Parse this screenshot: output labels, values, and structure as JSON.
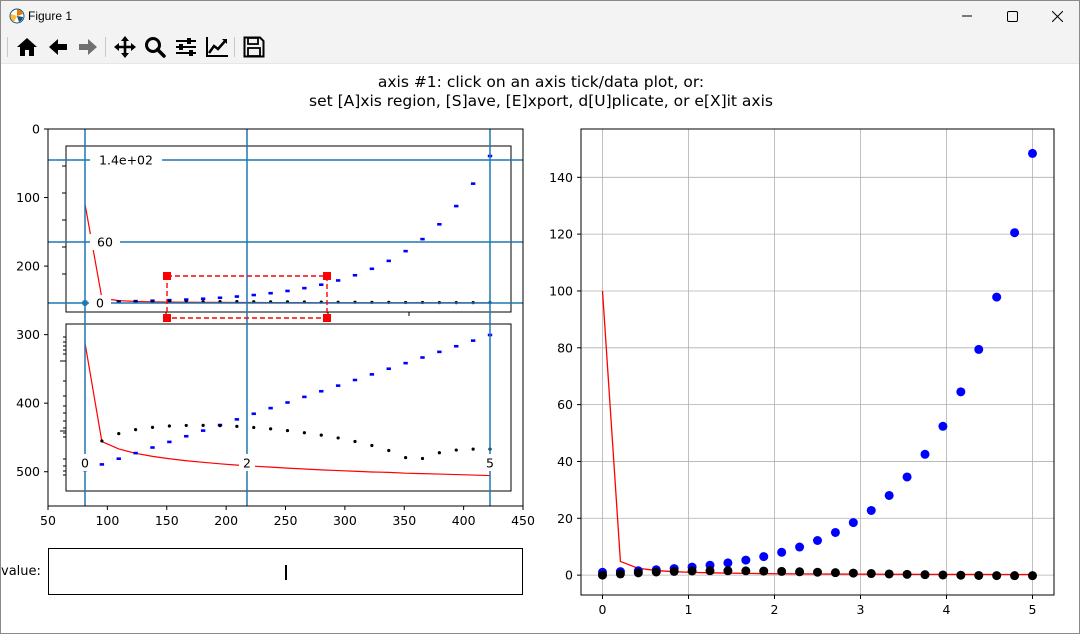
{
  "window": {
    "title": "Figure 1"
  },
  "toolbar": {
    "buttons": [
      {
        "name": "home-icon",
        "label": "Home"
      },
      {
        "name": "back-arrow-icon",
        "label": "Back"
      },
      {
        "name": "forward-arrow-icon",
        "label": "Forward"
      },
      {
        "name": "pan-icon",
        "label": "Pan"
      },
      {
        "name": "zoom-icon",
        "label": "Zoom"
      },
      {
        "name": "configure-subplots-icon",
        "label": "Subplots"
      },
      {
        "name": "edit-axis-icon",
        "label": "Customize"
      },
      {
        "name": "save-icon",
        "label": "Save"
      }
    ]
  },
  "figure": {
    "title_line1": "axis #1: click on an axis tick/data plot, or:",
    "title_line2": "set [A]xis region, [S]ave, [E]xport, d[U]plicate, or e[X]it axis"
  },
  "value_field": {
    "label": "value:",
    "value": ""
  },
  "colors": {
    "blue": "#0000ff",
    "red": "#ff0000",
    "black": "#000000",
    "guide": "#1f77b4",
    "selection": "#ff0000"
  },
  "chart_data": [
    {
      "type": "line",
      "description_of_axes": "image axes (left panel): pixel coordinates of the captured plot",
      "xlim": [
        50,
        450
      ],
      "ylim": [
        550,
        0
      ],
      "x_ticks": [
        "50",
        "100",
        "150",
        "200",
        "250",
        "300",
        "350",
        "400",
        "450"
      ],
      "y_ticks": [
        "0",
        "100",
        "200",
        "300",
        "400",
        "500"
      ],
      "axis_annotations": {
        "y_values": [
          "1.4e+02",
          "60",
          "0"
        ],
        "x_values": [
          "0",
          "2",
          "5"
        ]
      }
    },
    {
      "type": "scatter",
      "x_ticks": [
        "0",
        "1",
        "2",
        "3",
        "4",
        "5"
      ],
      "y_ticks": [
        "0",
        "20",
        "40",
        "60",
        "80",
        "100",
        "120",
        "140"
      ],
      "xlim": [
        -0.25,
        5.25
      ],
      "ylim": [
        -7,
        157
      ],
      "grid": true,
      "x": [
        0.0,
        0.2083,
        0.4167,
        0.625,
        0.8333,
        1.0417,
        1.25,
        1.4583,
        1.6667,
        1.875,
        2.0833,
        2.2917,
        2.5,
        2.7083,
        2.9167,
        3.125,
        3.3333,
        3.5417,
        3.75,
        3.9583,
        4.1667,
        4.375,
        4.5833,
        4.7917,
        5.0
      ],
      "series": [
        {
          "marker": "o",
          "color": "#0000ff",
          "values": [
            1.0,
            1.23,
            1.52,
            1.87,
            2.3,
            2.83,
            3.49,
            4.3,
            5.29,
            6.52,
            8.03,
            9.89,
            12.18,
            15.0,
            18.48,
            22.76,
            28.03,
            34.53,
            42.52,
            52.37,
            64.5,
            79.44,
            97.84,
            120.5,
            148.4
          ]
        },
        {
          "marker": "o",
          "color": "#000000",
          "values": [
            0.0,
            0.43,
            0.8,
            1.1,
            1.31,
            1.45,
            1.52,
            1.53,
            1.49,
            1.41,
            1.3,
            1.17,
            1.02,
            0.86,
            0.71,
            0.56,
            0.41,
            0.28,
            0.16,
            0.05,
            -0.04,
            -0.12,
            -0.17,
            -0.19,
            -0.19
          ]
        },
        {
          "marker": "-",
          "color": "#ff0000",
          "values": [
            100.0,
            4.8,
            2.4,
            1.6,
            1.2,
            0.96,
            0.8,
            0.69,
            0.6,
            0.53,
            0.48,
            0.44,
            0.4,
            0.37,
            0.34,
            0.32,
            0.3,
            0.28,
            0.27,
            0.25,
            0.24,
            0.23,
            0.22,
            0.21,
            0.2
          ]
        }
      ]
    }
  ]
}
